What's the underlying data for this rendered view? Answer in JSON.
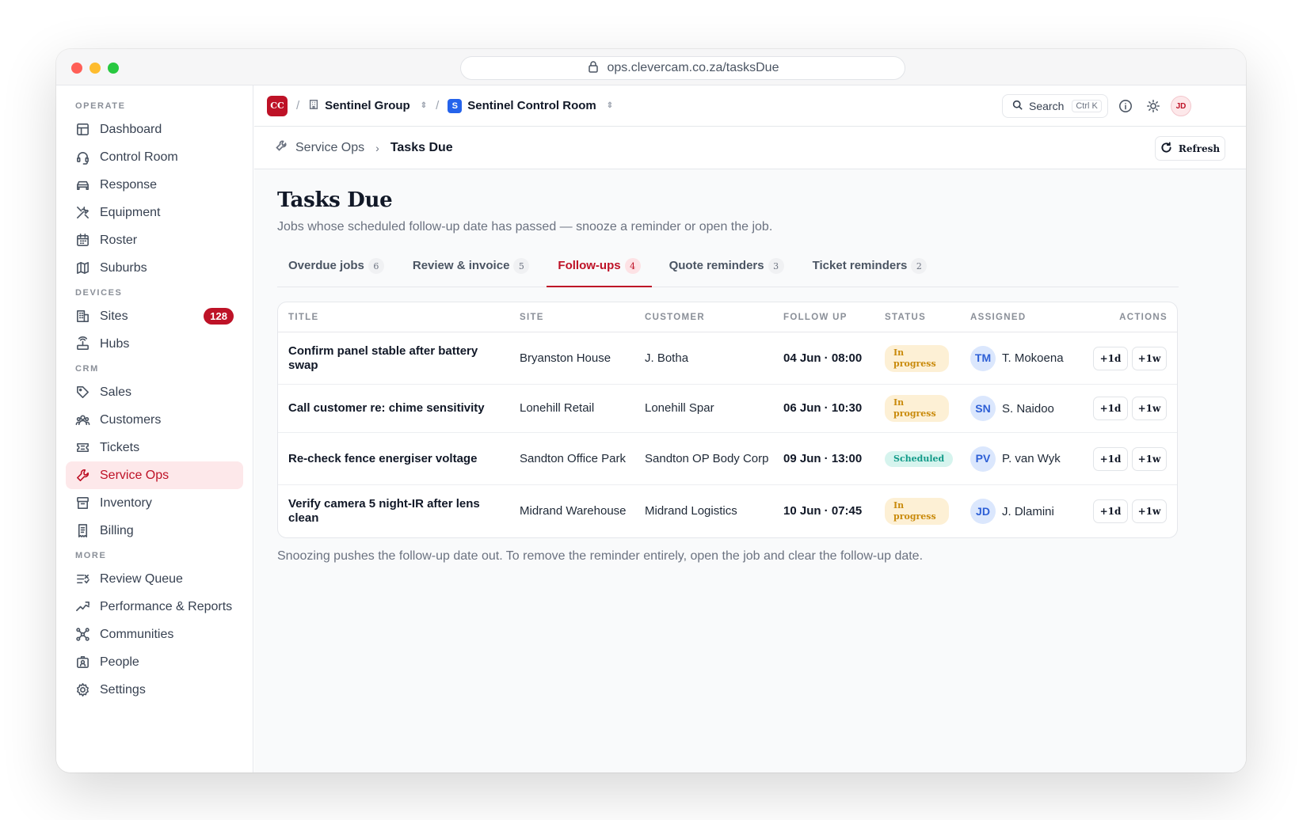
{
  "browser": {
    "url": "ops.clevercam.co.za/tasksDue"
  },
  "sidebar": {
    "sections": [
      {
        "title": "OPERATE",
        "items": [
          {
            "label": "Dashboard",
            "icon": "layout-icon"
          },
          {
            "label": "Control Room",
            "icon": "headset-icon"
          },
          {
            "label": "Response",
            "icon": "car-icon"
          },
          {
            "label": "Equipment",
            "icon": "tools-icon"
          },
          {
            "label": "Roster",
            "icon": "calendar-icon"
          },
          {
            "label": "Suburbs",
            "icon": "map-icon"
          }
        ]
      },
      {
        "title": "DEVICES",
        "items": [
          {
            "label": "Sites",
            "icon": "building-icon",
            "badge": "128"
          },
          {
            "label": "Hubs",
            "icon": "router-icon"
          }
        ]
      },
      {
        "title": "CRM",
        "items": [
          {
            "label": "Sales",
            "icon": "tag-icon"
          },
          {
            "label": "Customers",
            "icon": "users-icon"
          },
          {
            "label": "Tickets",
            "icon": "ticket-icon"
          },
          {
            "label": "Service Ops",
            "icon": "wrench-icon",
            "active": true
          },
          {
            "label": "Inventory",
            "icon": "archive-icon"
          },
          {
            "label": "Billing",
            "icon": "receipt-icon"
          }
        ]
      },
      {
        "title": "MORE",
        "items": [
          {
            "label": "Review Queue",
            "icon": "list-check-icon"
          },
          {
            "label": "Performance & Reports",
            "icon": "trend-icon"
          },
          {
            "label": "Communities",
            "icon": "network-icon"
          },
          {
            "label": "People",
            "icon": "id-card-icon"
          },
          {
            "label": "Settings",
            "icon": "gear-icon"
          }
        ]
      }
    ]
  },
  "topbar": {
    "logo": "CC",
    "org": "Sentinel Group",
    "room_badge": "S",
    "room": "Sentinel Control Room",
    "search_label": "Search",
    "search_shortcut": "Ctrl K",
    "user_initials": "JD"
  },
  "breadcrumb": {
    "parent": "Service Ops",
    "current": "Tasks Due",
    "refresh_label": "Refresh"
  },
  "page": {
    "title": "Tasks Due",
    "subtitle": "Jobs whose scheduled follow-up date has passed — snooze a reminder or open the job.",
    "note": "Snoozing pushes the follow-up date out. To remove the reminder entirely, open the job and clear the follow-up date."
  },
  "tabs": [
    {
      "label": "Overdue jobs",
      "count": "6"
    },
    {
      "label": "Review & invoice",
      "count": "5"
    },
    {
      "label": "Follow-ups",
      "count": "4",
      "active": true
    },
    {
      "label": "Quote reminders",
      "count": "3"
    },
    {
      "label": "Ticket reminders",
      "count": "2"
    }
  ],
  "table": {
    "columns": [
      "TITLE",
      "SITE",
      "CUSTOMER",
      "FOLLOW UP",
      "STATUS",
      "ASSIGNED",
      "ACTIONS"
    ],
    "rows": [
      {
        "title": "Confirm panel stable after battery swap",
        "site": "Bryanston House",
        "customer": "J. Botha",
        "follow_up": "04 Jun · 08:00",
        "status": "In progress",
        "status_kind": "progress",
        "initials": "TM",
        "assignee": "T. Mokoena",
        "snooze_day": "+1d",
        "snooze_week": "+1w"
      },
      {
        "title": "Call customer re: chime sensitivity",
        "site": "Lonehill Retail",
        "customer": "Lonehill Spar",
        "follow_up": "06 Jun · 10:30",
        "status": "In progress",
        "status_kind": "progress",
        "initials": "SN",
        "assignee": "S. Naidoo",
        "snooze_day": "+1d",
        "snooze_week": "+1w"
      },
      {
        "title": "Re-check fence energiser voltage",
        "site": "Sandton Office Park",
        "customer": "Sandton OP Body Corp",
        "follow_up": "09 Jun · 13:00",
        "status": "Scheduled",
        "status_kind": "scheduled",
        "initials": "PV",
        "assignee": "P. van Wyk",
        "snooze_day": "+1d",
        "snooze_week": "+1w"
      },
      {
        "title": "Verify camera 5 night-IR after lens clean",
        "site": "Midrand Warehouse",
        "customer": "Midrand Logistics",
        "follow_up": "10 Jun · 07:45",
        "status": "In progress",
        "status_kind": "progress",
        "initials": "JD",
        "assignee": "J. Dlamini",
        "snooze_day": "+1d",
        "snooze_week": "+1w"
      }
    ]
  },
  "colors": {
    "accent": "#be1227",
    "accent_bg": "#fde8ea",
    "progress": "#c98a0b",
    "scheduled": "#119a88",
    "avatar": "#2d5fd6"
  }
}
